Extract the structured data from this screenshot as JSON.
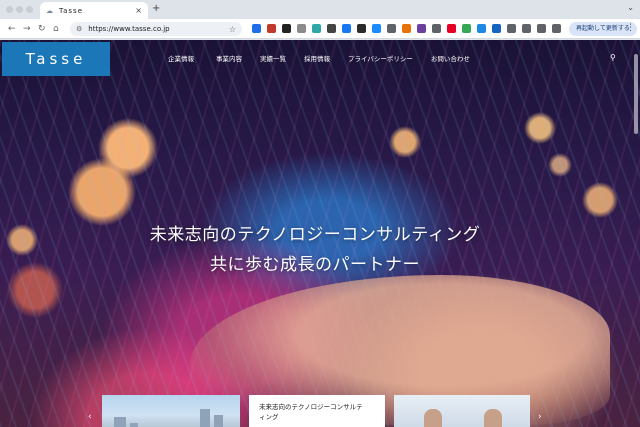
{
  "browser": {
    "tab_title": "Tasse",
    "tab_close": "×",
    "new_tab": "+",
    "tab_menu": "⌄",
    "url": "https://www.tasse.co.jp",
    "restart_label": "再起動して更新する",
    "icons": {
      "back": "back-arrow-icon",
      "forward": "forward-arrow-icon",
      "reload": "reload-icon",
      "home": "home-icon",
      "star": "bookmark-star-icon",
      "menu": "kebab-menu-icon"
    },
    "extension_colors": [
      "#1f6feb",
      "#c0392b",
      "#222222",
      "#8a8a8a",
      "#2ea8a8",
      "#444444",
      "#1877f2",
      "#2b2b2b",
      "#1a8cff",
      "#5f6368",
      "#e8710a",
      "#6b3fa0",
      "#5f6368",
      "#e60023",
      "#34a853",
      "#1e88e5",
      "#1565c0",
      "#5f6368",
      "#5f6368",
      "#5f6368",
      "#5f6368"
    ]
  },
  "site": {
    "logo": "Tasse",
    "nav": [
      "企業情報",
      "事業内容",
      "実績一覧",
      "採用情報",
      "プライバシーポリシー",
      "お問い合わせ"
    ],
    "search_icon": "search-icon",
    "hero": {
      "line1": "未来志向のテクノロジーコンサルティング",
      "line2": "共に歩む成長のパートナー"
    },
    "carousel": {
      "prev": "‹",
      "next": "›",
      "card2_text_1": "未来志向のテクノロジーコンサルテ",
      "card2_text_2": "ィング"
    }
  }
}
